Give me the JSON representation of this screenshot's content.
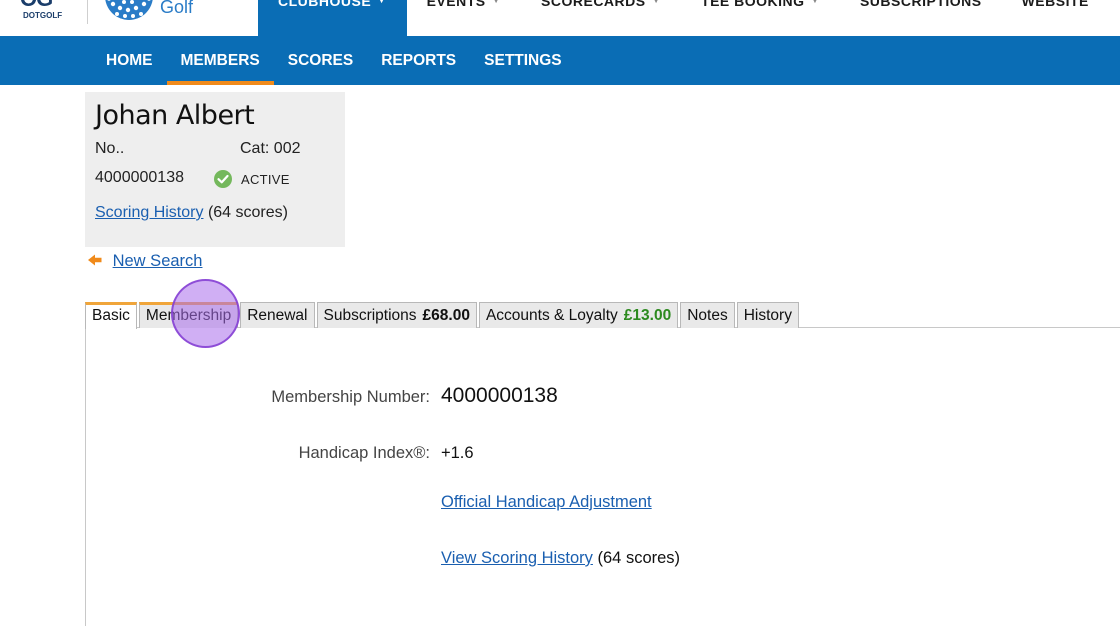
{
  "brand": {
    "dotgolf_mark": "OG",
    "dotgolf_word": "DOTGOLF",
    "golf_word": "Golf"
  },
  "top_nav": [
    {
      "label": "CLUBHOUSE",
      "active": true
    },
    {
      "label": "EVENTS",
      "active": false
    },
    {
      "label": "SCORECARDS",
      "active": false
    },
    {
      "label": "TEE BOOKING",
      "active": false
    },
    {
      "label": "SUBSCRIPTIONS",
      "active": false
    },
    {
      "label": "WEBSITE",
      "active": false
    }
  ],
  "sub_nav": [
    {
      "label": "HOME",
      "active": false
    },
    {
      "label": "MEMBERS",
      "active": true
    },
    {
      "label": "SCORES",
      "active": false
    },
    {
      "label": "REPORTS",
      "active": false
    },
    {
      "label": "SETTINGS",
      "active": false
    }
  ],
  "member": {
    "name": "Johan Albert",
    "no_label": "No..",
    "cat": "Cat: 002",
    "number": "4000000138",
    "status": "ACTIVE",
    "scoring_history_link": "Scoring History",
    "scoring_count": "(64 scores)"
  },
  "new_search": "New Search",
  "tabs": [
    {
      "label": "Basic",
      "amount": ""
    },
    {
      "label": "Membership",
      "amount": ""
    },
    {
      "label": "Renewal",
      "amount": ""
    },
    {
      "label": "Subscriptions",
      "amount": "£68.00"
    },
    {
      "label": "Accounts & Loyalty",
      "amount": "£13.00"
    },
    {
      "label": "Notes",
      "amount": ""
    },
    {
      "label": "History",
      "amount": ""
    }
  ],
  "details": {
    "membership_number_label": "Membership Number:",
    "membership_number": "4000000138",
    "handicap_label": "Handicap Index®:",
    "handicap_value": "+1.6",
    "adjustment_link": "Official Handicap Adjustment",
    "view_history_link": "View Scoring History",
    "view_history_count": "(64 scores)"
  },
  "colors": {
    "primary_blue": "#0a6db5",
    "accent_orange": "#f08a1a",
    "link_blue": "#1a5fb0",
    "loyalty_green": "#2c8a1f",
    "active_green": "#74b85c"
  }
}
